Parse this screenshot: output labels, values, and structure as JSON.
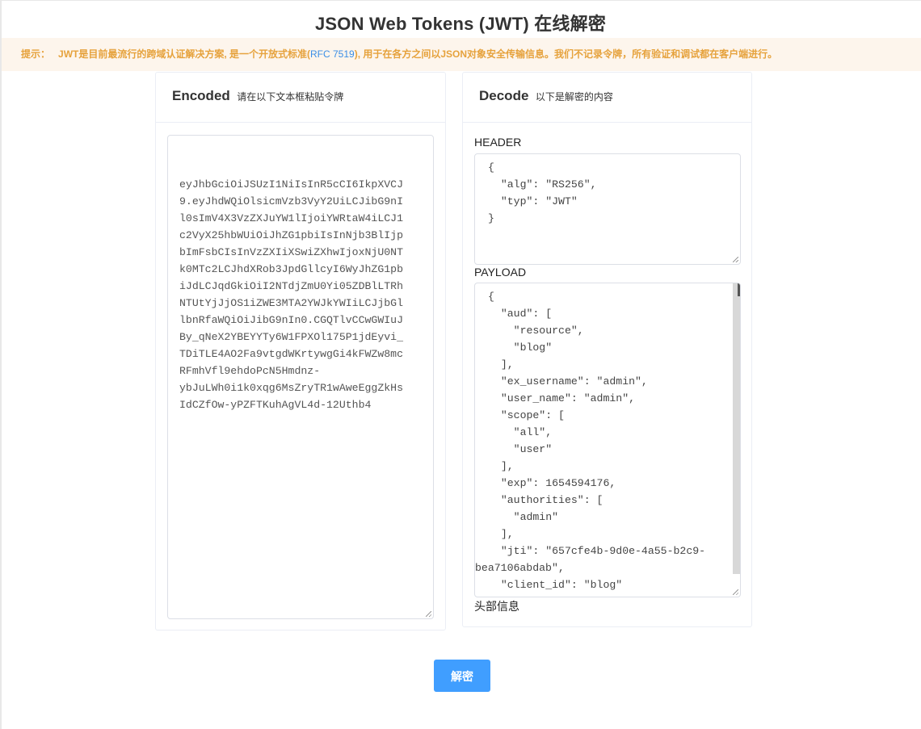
{
  "title": "JSON Web Tokens (JWT) 在线解密",
  "notice": {
    "lead": "提示：",
    "text_before": "JWT是目前最流行的跨域认证解决方案, 是一个开放式标准(",
    "link": "RFC 7519",
    "text_after": "), 用于在各方之间以JSON对象安全传输信息。我们不记录令牌，所有验证和调试都在客户端进行。"
  },
  "encoded": {
    "title": "Encoded",
    "subtitle": "请在以下文本框粘贴令牌",
    "token_lines": [
      "eyJhbGciOiJSUzI1NiIsInR5cCI6IkpXVCJ",
      "9.eyJhdWQiOlsicmVzb3VyY2UiLCJibG9nI",
      "l0sImV4X3VzZXJuYW1lIjoiYWRtaW4iLCJ1",
      "c2VyX25hbWUiOiJhZG1pbiIsInNjb3BlIjp",
      "bImFsbCIsInVzZXIiXSwiZXhwIjoxNjU0NT",
      "k0MTc2LCJhdXRob3JpdGllcyI6WyJhZG1pb",
      "iJdLCJqdGkiOiI2NTdjZmU0Yi05ZDBlLTRh",
      "NTUtYjJjOS1iZWE3MTA2YWJkYWIiLCJjbGl",
      "lbnRfaWQiOiJibG9nIn0.CGQTlvCCwGWIuJ",
      "By_qNeX2YBEYYTy6W1FPXOl175P1jdEyvi_",
      "TDiTLE4AO2Fa9vtgdWKrtywgGi4kFWZw8mc",
      "RFmhVfl9ehdoPcN5Hmdnz-",
      "ybJuLWh0i1k0xqg6MsZryTR1wAweEggZkHs",
      "IdCZfOw-yPZFTKuhAgVL4d-12Uthb4"
    ]
  },
  "decode": {
    "title": "Decode",
    "subtitle": "以下是解密的内容",
    "header_label": "HEADER",
    "header_lines": [
      "{",
      "  \"alg\": \"RS256\",",
      "  \"typ\": \"JWT\"",
      "}"
    ],
    "payload_label": "PAYLOAD",
    "payload_lines": [
      "{",
      "  \"aud\": [",
      "    \"resource\",",
      "    \"blog\"",
      "  ],",
      "  \"ex_username\": \"admin\",",
      "  \"user_name\": \"admin\",",
      "  \"scope\": [",
      "    \"all\",",
      "    \"user\"",
      "  ],",
      "  \"exp\": 1654594176,",
      "  \"authorities\": [",
      "    \"admin\"",
      "  ],",
      "  \"jti\": \"657cfe4b-9d0e-4a55-b2c9-",
      "bea7106abdab\",",
      "  \"client_id\": \"blog\""
    ],
    "footer_note": "头部信息"
  },
  "decode_button_label": "解密",
  "colors": {
    "accent": "#409eff",
    "notice_bg": "#fdf5ec",
    "notice_text": "#e6a23c",
    "link": "#3a8ee6"
  }
}
